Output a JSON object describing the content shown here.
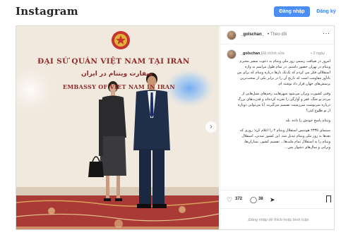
{
  "app": {
    "logo": "Instagram",
    "login_label": "Đăng nhập",
    "signup_label": "Đăng ký"
  },
  "post": {
    "photo": {
      "sign_vietnamese": "ĐẠI SỨ QUÁN VIỆT NAM TẠI IRAN",
      "sign_persian": "سفارت ویتنام در ایران",
      "sign_english": "EMBASSY OF VIET NAM IN IRAN",
      "carousel_next_icon": "chevron-right-icon"
    },
    "header": {
      "username": "_golschan_",
      "separator": "•",
      "follow_label": "Theo dõi",
      "more_icon": "more-options-icon"
    },
    "caption": {
      "username": "_golschan_",
      "edited_label": "Đã chỉnh sửa",
      "time": "• 2 ngày",
      "paragraphs": [
        "امروز در ضیافت رسمی روز ملی ویتنام به دعوت سفیر محترم ویتنام در تهران حضور داشتم. در تمام طول مراسم به واژه استقلالی فکر می کردم که تک‌تک بارها درباره ویتنام که برای من یادآور مقاومت است که تاریخ آن را در برابر یکی از سخت‌ترین پرسش‌های جهان قرار داد نوشته ام.",
        "وقتی کشورت ویران می‌شود شهرهایت زخم‌های نسل‌هایی از مردم تو جنگ، فقر و آوارگی را تجربه کرده‌اند و قدرت‌های بزرگ درباره سرنوشت سرزمینت تصمیم می‌گیرند، آیا می‌توانی دوباره از نو طلوع کنی؟",
        "ویتنام پاسخ خودش را داده. بله",
        "سینمای ۲۳۳۵ هونتنس استقلال ویتنام ۲ را اعلام کرد؛ روزی که بعدها به روز ملی ویتنام تبدیل شد. این کشور تمدنی، استقلال ویتنام را به استقلال تمام ملت‌ها... تقسیم کشور، بمباران‌ها، ویرانی و سال‌های دشوار پس..."
      ]
    },
    "actions": {
      "like_icon": "heart-icon",
      "like_count": "372",
      "comment_icon": "comment-icon",
      "comment_count": "38",
      "share_icon": "share-icon",
      "bookmark_icon": "bookmark-icon"
    },
    "login_prompt": "Đăng nhập để thích hoặc bình luận."
  }
}
